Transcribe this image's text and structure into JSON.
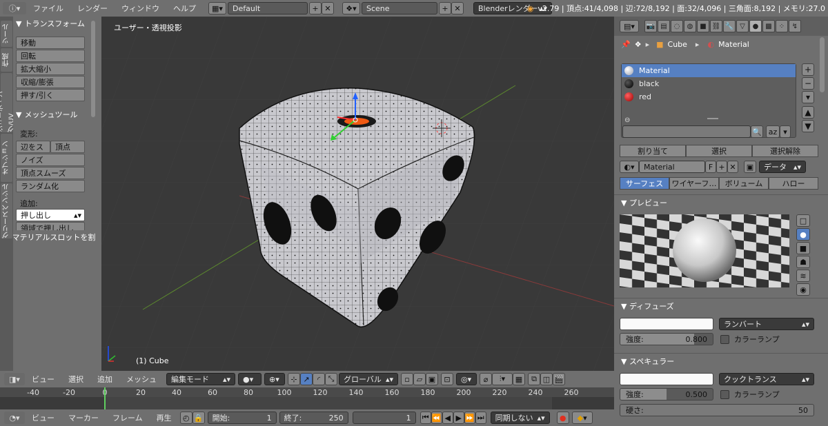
{
  "topbar": {
    "menus": [
      "ファイル",
      "レンダー",
      "ウィンドウ",
      "ヘルプ"
    ],
    "screen_layout": "Default",
    "scene": "Scene",
    "render_engine": "Blenderレンダー",
    "status": "v2.79 | 頂点:41/4,098 | 辺:72/8,192 | 面:32/4,096 | 三角面:8,192 | メモリ:27.0"
  },
  "tool_tabs": [
    "ツール",
    "作成",
    "シェーディング/UV",
    "オプション",
    "グリースペンシル"
  ],
  "tool_shelf": {
    "transform_header": "トランスフォーム",
    "transform_buttons": [
      "移動",
      "回転",
      "拡大縮小",
      "収縮/膨張",
      "押す/引く"
    ],
    "mesh_tools_header": "メッシュツール",
    "deform_label": "変形:",
    "slide_edge": "辺をス",
    "slide_vertex": "頂点",
    "deform_buttons": [
      "ノイズ",
      "頂点スムーズ",
      "ランダム化"
    ],
    "add_label": "追加:",
    "extrude": "押し出し",
    "extrude_region": "領域で押し出し",
    "material_slot_header": "マテリアルスロットを割"
  },
  "viewport": {
    "view_label": "ユーザー・透視投影",
    "object_label": "(1) Cube"
  },
  "viewport_header": {
    "menus": [
      "ビュー",
      "選択",
      "追加",
      "メッシュ"
    ],
    "mode": "編集モード",
    "orientation": "グローバル"
  },
  "timeline": {
    "ticks": [
      -40,
      -20,
      0,
      20,
      40,
      60,
      80,
      100,
      120,
      140,
      160,
      180,
      200,
      220,
      240,
      260
    ],
    "current_frame_marker": 0
  },
  "timeline_header": {
    "menus": [
      "ビュー",
      "マーカー",
      "フレーム",
      "再生"
    ],
    "start_label": "開始:",
    "start_value": "1",
    "end_label": "終了:",
    "end_value": "250",
    "current_frame": "1",
    "sync": "同期しない"
  },
  "properties": {
    "breadcrumb_object": "Cube",
    "breadcrumb_material": "Material",
    "materials": [
      {
        "name": "Material",
        "color": "#d8d8d8"
      },
      {
        "name": "black",
        "color": "#000000"
      },
      {
        "name": "red",
        "color": "#cc1010"
      }
    ],
    "assign": "割り当て",
    "select": "選択",
    "deselect": "選択解除",
    "material_name": "Material",
    "fake_user": "F",
    "link": "データ",
    "tabs": [
      "サーフェス",
      "ワイヤーフ…",
      "ボリューム",
      "ハロー"
    ],
    "preview_header": "プレビュー",
    "diffuse_header": "ディフューズ",
    "diffuse_shader": "ランバート",
    "diffuse_intensity_label": "強度:",
    "diffuse_intensity": "0.800",
    "ramp_label": "カラーランプ",
    "specular_header": "スペキュラー",
    "specular_shader": "クックトランス",
    "specular_intensity_label": "強度:",
    "specular_intensity": "0.500",
    "hardness_label": "硬さ:",
    "hardness": "50"
  }
}
